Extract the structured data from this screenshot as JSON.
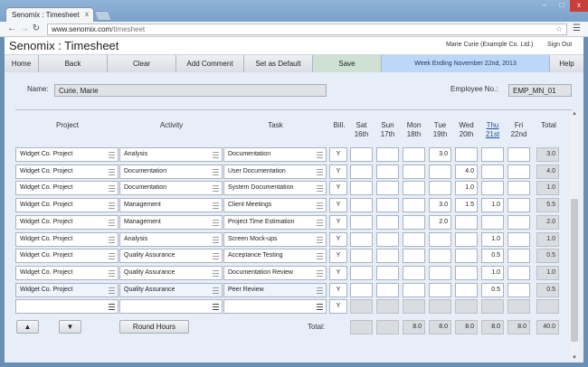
{
  "browser": {
    "tab_title": "Senomix : Timesheet",
    "tab_close": "x",
    "url_host": "www.senomix.com",
    "url_path": "/timesheet",
    "window_controls": [
      "–",
      "□",
      "x"
    ]
  },
  "app": {
    "title": "Senomix : Timesheet",
    "user": "Marie Curie  (Example Co. Ltd.)",
    "sign_out": "Sign Out"
  },
  "toolbar": {
    "home": "Home",
    "back": "Back",
    "clear": "Clear",
    "add_comment": "Add Comment",
    "set_default": "Set as Default",
    "save": "Save",
    "week": "Week Ending November 22nd, 2013",
    "help": "Help"
  },
  "header": {
    "name_label": "Name:",
    "name_value": "Curie, Marie",
    "employee_label": "Employee No.:",
    "employee_value": "EMP_MN_01"
  },
  "columns": {
    "project": "Project",
    "activity": "Activity",
    "task": "Task",
    "bill": "Bill.",
    "total": "Total",
    "days": [
      {
        "d": "Sat",
        "n": "16th"
      },
      {
        "d": "Sun",
        "n": "17th"
      },
      {
        "d": "Mon",
        "n": "18th"
      },
      {
        "d": "Tue",
        "n": "19th"
      },
      {
        "d": "Wed",
        "n": "20th"
      },
      {
        "d": "Thu",
        "n": "21st"
      },
      {
        "d": "Fri",
        "n": "22nd"
      }
    ]
  },
  "rows": [
    {
      "project": "Widget Co. Project",
      "activity": "Analysis",
      "task": "Documentation",
      "bill": "Y",
      "hours": [
        "",
        "",
        "",
        "3.0",
        "",
        "",
        ""
      ],
      "total": "3.0"
    },
    {
      "project": "Widget Co. Project",
      "activity": "Documentation",
      "task": "User Documentation",
      "bill": "Y",
      "hours": [
        "",
        "",
        "",
        "",
        "4.0",
        "",
        ""
      ],
      "total": "4.0"
    },
    {
      "project": "Widget Co. Project",
      "activity": "Documentation",
      "task": "System Documentation",
      "bill": "Y",
      "hours": [
        "",
        "",
        "",
        "",
        "1.0",
        "",
        ""
      ],
      "total": "1.0"
    },
    {
      "project": "Widget Co. Project",
      "activity": "Management",
      "task": "Client Meetings",
      "bill": "Y",
      "hours": [
        "",
        "",
        "",
        "3.0",
        "1.5",
        "1.0",
        ""
      ],
      "total": "5.5"
    },
    {
      "project": "Widget Co. Project",
      "activity": "Management",
      "task": "Project Time Estimation",
      "bill": "Y",
      "hours": [
        "",
        "",
        "",
        "2.0",
        "",
        "",
        ""
      ],
      "total": "2.0"
    },
    {
      "project": "Widget Co. Project",
      "activity": "Analysis",
      "task": "Screen Mock-ups",
      "bill": "Y",
      "hours": [
        "",
        "",
        "",
        "",
        "",
        "1.0",
        ""
      ],
      "total": "1.0"
    },
    {
      "project": "Widget Co. Project",
      "activity": "Quality Assurance",
      "task": "Acceptance Testing",
      "bill": "Y",
      "hours": [
        "",
        "",
        "",
        "",
        "",
        "0.5",
        ""
      ],
      "total": "0.5"
    },
    {
      "project": "Widget Co. Project",
      "activity": "Quality Assurance",
      "task": "Documentation Review",
      "bill": "Y",
      "hours": [
        "",
        "",
        "",
        "",
        "",
        "1.0",
        ""
      ],
      "total": "1.0"
    },
    {
      "project": "Widget Co. Project",
      "activity": "Quality Assurance",
      "task": "Peer Review",
      "bill": "Y",
      "hours": [
        "",
        "",
        "",
        "",
        "",
        "0.5",
        ""
      ],
      "total": "0.5"
    },
    {
      "project": "",
      "activity": "",
      "task": "",
      "bill": "Y",
      "hours": [
        "",
        "",
        "",
        "",
        "",
        "",
        ""
      ],
      "total": ""
    }
  ],
  "footer": {
    "up_label": "▲",
    "down_label": "▼",
    "round_hours": "Round Hours",
    "total_label": "Total:",
    "day_totals": [
      "",
      "",
      "8.0",
      "8.0",
      "8.0",
      "8.0",
      "8.0"
    ],
    "grand_total": "40.0"
  }
}
